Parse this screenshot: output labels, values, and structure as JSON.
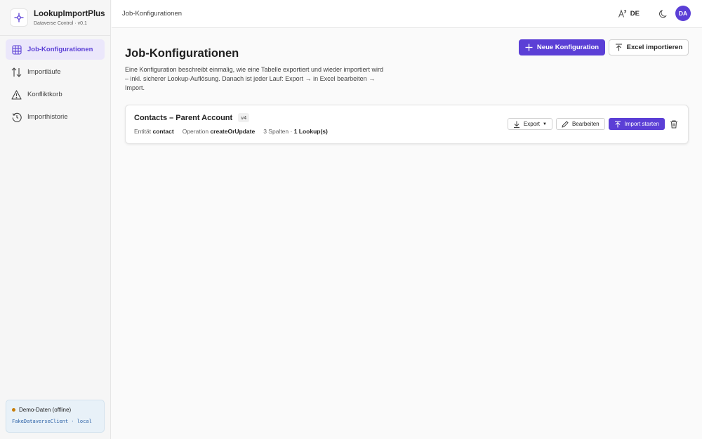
{
  "brand": {
    "name": "LookupImportPlus",
    "subtitle": "Dataverse Control · v0.1",
    "icon": "lookup-node-icon"
  },
  "nav": [
    {
      "label": "Job-Konfigurationen",
      "icon": "table-grid-icon",
      "active": true
    },
    {
      "label": "Importläufe",
      "icon": "arrows-up-down-icon",
      "active": false
    },
    {
      "label": "Konfliktkorb",
      "icon": "warning-icon",
      "active": false
    },
    {
      "label": "Importhistorie",
      "icon": "history-icon",
      "active": false
    }
  ],
  "status": {
    "label": "Demo-Daten (offline)",
    "client": "FakeDataverseClient · local"
  },
  "topbar": {
    "breadcrumb": "Job-Konfigurationen",
    "language": "DE",
    "avatar": "DA"
  },
  "page": {
    "title": "Job-Konfigurationen",
    "description": "Eine Konfiguration beschreibt einmalig, wie eine Tabelle exportiert und wieder importiert wird – inkl. sicherer Lookup-Auflösung. Danach ist jeder Lauf: Export → in Excel bearbeiten → Import.",
    "new_button": "Neue Konfiguration",
    "import_button": "Excel importieren"
  },
  "configs": [
    {
      "name": "Contacts – Parent Account",
      "version": "v4",
      "entity_label": "Entität",
      "entity": "contact",
      "operation_label": "Operation",
      "operation": "createOrUpdate",
      "columns": "3 Spalten · ",
      "lookups": "1 Lookup(s)",
      "export_label": "Export",
      "edit_label": "Bearbeiten",
      "start_label": "Import starten"
    }
  ],
  "colors": {
    "accent": "#5b3fd6",
    "status_dot": "#c77d09",
    "status_bg": "#e8f1f8"
  }
}
